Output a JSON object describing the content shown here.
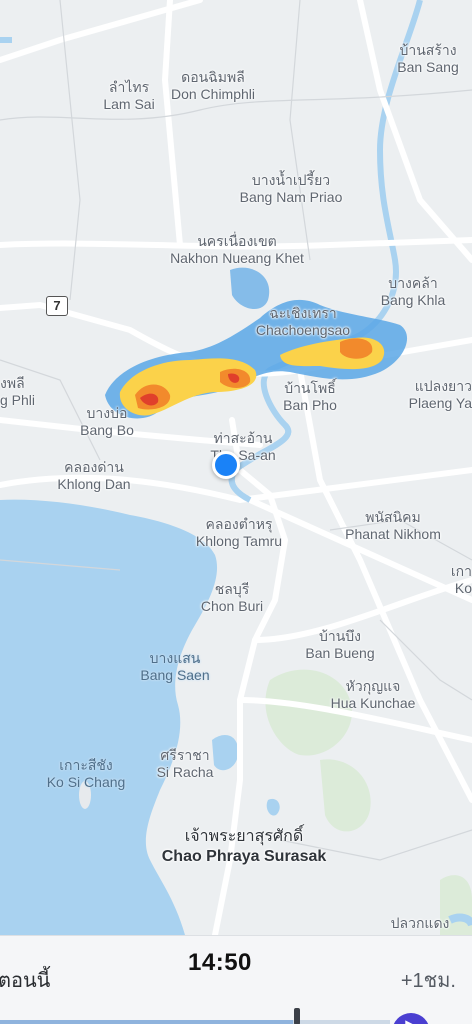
{
  "map": {
    "highway_shield": "7",
    "places": [
      {
        "id": "ban-sang",
        "th": "บ้านสร้าง",
        "en": "Ban Sang"
      },
      {
        "id": "lam-sai",
        "th": "ลำไทร",
        "en": "Lam Sai"
      },
      {
        "id": "don-chimphli",
        "th": "ดอนฉิมพลี",
        "en": "Don Chimphli"
      },
      {
        "id": "bang-nam-priao",
        "th": "บางน้ำเปรี้ยว",
        "en": "Bang Nam Priao"
      },
      {
        "id": "nakhon-nueang-khet",
        "th": "นครเนื่องเขต",
        "en": "Nakhon Nueang Khet"
      },
      {
        "id": "bang-khla",
        "th": "บางคล้า",
        "en": "Bang Khla"
      },
      {
        "id": "chachoengsao",
        "th": "ฉะเชิงเทรา",
        "en": "Chachoengsao"
      },
      {
        "id": "bang-phli",
        "th": "งพลี",
        "en": "g Phli"
      },
      {
        "id": "bang-bo",
        "th": "บางบ่อ",
        "en": "Bang Bo"
      },
      {
        "id": "ban-pho",
        "th": "บ้านโพธิ์",
        "en": "Ban Pho"
      },
      {
        "id": "plaeng-yao",
        "th": "แปลงยาว",
        "en": "Plaeng Ya"
      },
      {
        "id": "tha-sa-an",
        "th": "ท่าสะอ้าน",
        "en": "Tha Sa-an"
      },
      {
        "id": "khlong-dan",
        "th": "คลองด่าน",
        "en": "Khlong Dan"
      },
      {
        "id": "khlong-tamru",
        "th": "คลองตำหรุ",
        "en": "Khlong Tamru"
      },
      {
        "id": "phanat-nikhom",
        "th": "พนัสนิคม",
        "en": "Phanat Nikhom"
      },
      {
        "id": "ko-edge",
        "th": "เกา",
        "en": "Ko"
      },
      {
        "id": "chon-buri",
        "th": "ชลบุรี",
        "en": "Chon Buri"
      },
      {
        "id": "ban-bueng",
        "th": "บ้านบึง",
        "en": "Ban Bueng"
      },
      {
        "id": "bang-saen",
        "th": "บางแสน",
        "en": "Bang Saen"
      },
      {
        "id": "hua-kunchae",
        "th": "หัวกุญแจ",
        "en": "Hua Kunchae"
      },
      {
        "id": "ko-si-chang",
        "th": "เกาะสีชัง",
        "en": "Ko Si Chang"
      },
      {
        "id": "si-racha",
        "th": "ศรีราชา",
        "en": "Si Racha"
      },
      {
        "id": "chao-phraya-surasak",
        "th": "เจ้าพระยาสุรศักดิ์",
        "en": "Chao Phraya Surasak"
      },
      {
        "id": "pluak-daeng",
        "th": "ปลวกแดง",
        "en": ""
      }
    ],
    "colors": {
      "land": "#eceff1",
      "sea": "#a9d2f0",
      "road": "#ffffff",
      "radar_light": "#5aa7e6",
      "radar_yellow": "#fbd24a",
      "radar_orange": "#f28a2c",
      "radar_red": "#e0402b",
      "location": "#1a82f7"
    }
  },
  "timeline": {
    "now_label": "ตอนนี้",
    "time_label": "14:50",
    "next_label": "+1ชม.",
    "progress": 0.75,
    "play_icon": "play-icon"
  }
}
